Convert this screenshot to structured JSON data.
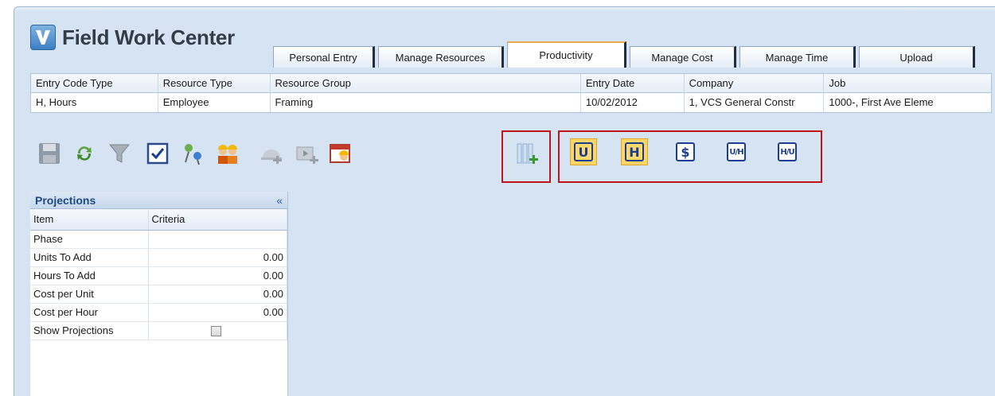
{
  "app": {
    "title": "Field Work Center"
  },
  "tabs": [
    {
      "label": "Personal Entry"
    },
    {
      "label": "Manage Resources"
    },
    {
      "label": "Productivity"
    },
    {
      "label": "Manage Cost"
    },
    {
      "label": "Manage Time"
    },
    {
      "label": "Upload"
    }
  ],
  "header_grid": {
    "columns": [
      "Entry Code Type",
      "Resource Type",
      "Resource Group",
      "Entry Date",
      "Company",
      "Job"
    ],
    "row": [
      "H, Hours",
      "Employee",
      "Framing",
      "10/02/2012",
      "1, VCS General Constr",
      "1000-, First Ave Eleme"
    ]
  },
  "toolbar": {
    "icons": [
      "save-icon",
      "refresh-icon",
      "filter-icon",
      "checkbox-icon",
      "pushpin-icon",
      "workers-icon",
      "hardhat-add-icon",
      "film-add-icon",
      "calendar-worker-icon",
      "columns-add-icon"
    ],
    "unit_buttons": [
      {
        "label": "U",
        "active": true
      },
      {
        "label": "H",
        "active": true
      },
      {
        "label": "$",
        "active": false
      },
      {
        "label": "U/H",
        "active": false
      },
      {
        "label": "H/U",
        "active": false
      }
    ],
    "highlight_color": "#c0141b"
  },
  "projections": {
    "title": "Projections",
    "collapse_glyph": "«",
    "col_item": "Item",
    "col_criteria": "Criteria",
    "rows": [
      {
        "item": "Phase",
        "value": ""
      },
      {
        "item": "Units To Add",
        "value": "0.00"
      },
      {
        "item": "Hours To Add",
        "value": "0.00"
      },
      {
        "item": "Cost per Unit",
        "value": "0.00"
      },
      {
        "item": "Cost per Hour",
        "value": "0.00"
      },
      {
        "item": "Show Projections",
        "value": ""
      }
    ]
  }
}
